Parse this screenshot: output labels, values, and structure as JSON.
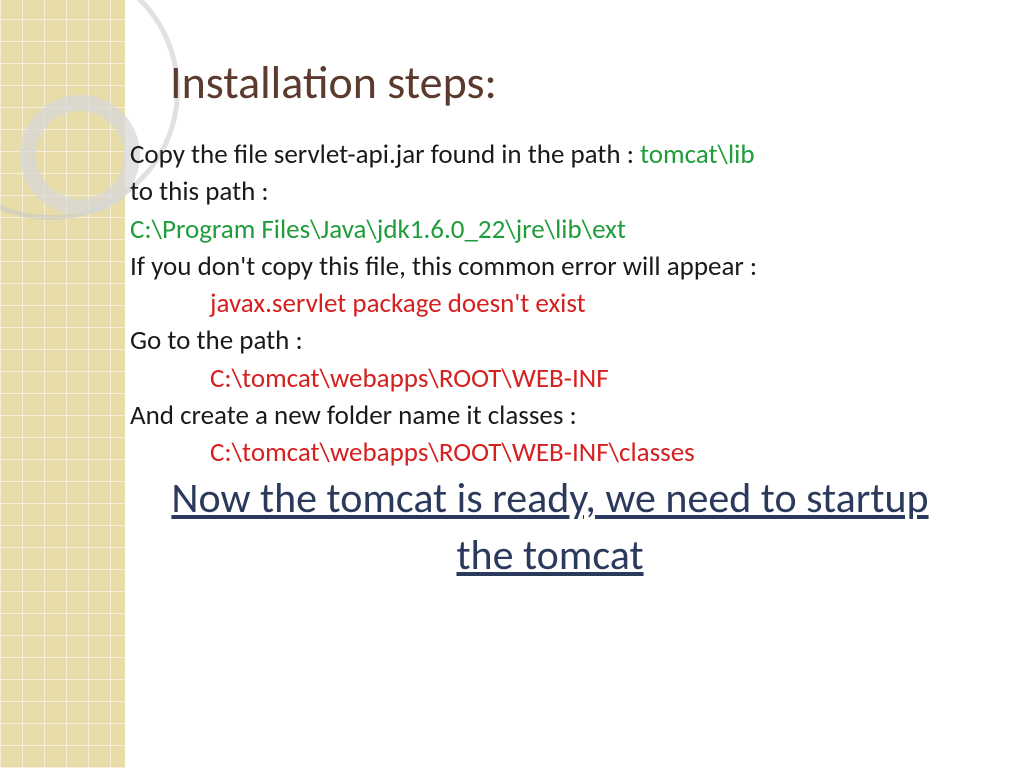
{
  "title": "Installation steps:",
  "line1a": "Copy the file servlet-api.jar found in the path  : ",
  "line1b": "tomcat\\lib",
  "line2": "to this path :",
  "line3": "C:\\Program Files\\Java\\jdk1.6.0_22\\jre\\lib\\ext",
  "line4": "If you don't copy this file, this common error will appear :",
  "line5": "javax.servlet package doesn't exist",
  "line6": "Go to the path :",
  "line7": "C:\\tomcat\\webapps\\ROOT\\WEB-INF",
  "line8": "And create a new folder name it classes :",
  "line9": "C:\\tomcat\\webapps\\ROOT\\WEB-INF\\classes",
  "final": "Now the tomcat is ready,  we need to startup the tomcat"
}
